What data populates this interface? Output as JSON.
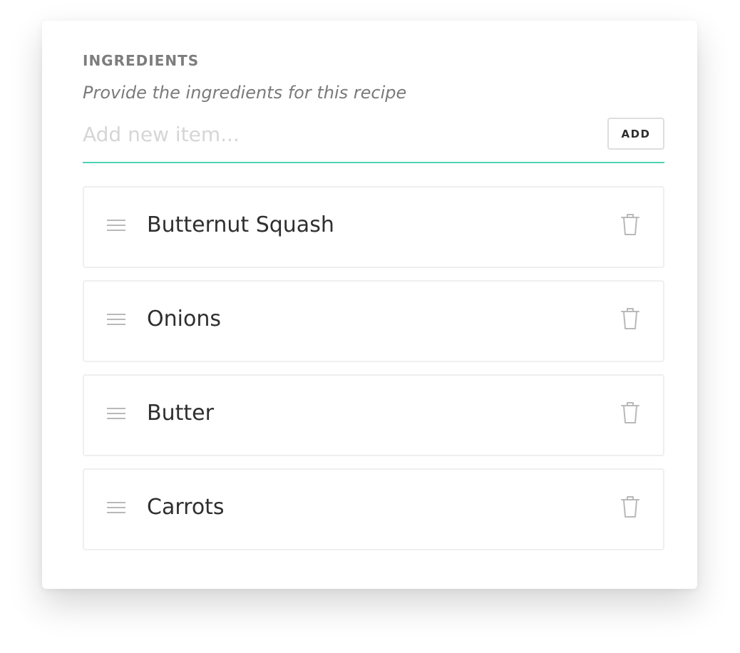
{
  "ingredients": {
    "title": "INGREDIENTS",
    "subtitle": "Provide the ingredients for this recipe",
    "input": {
      "placeholder": "Add new item...",
      "value": ""
    },
    "add_label": "ADD",
    "items": [
      {
        "label": "Butternut Squash"
      },
      {
        "label": "Onions"
      },
      {
        "label": "Butter"
      },
      {
        "label": "Carrots"
      }
    ]
  },
  "icons": {
    "drag": "drag-handle-icon",
    "delete": "trash-icon"
  },
  "colors": {
    "accent": "#4fd3b3",
    "title_text": "#7d7d7d",
    "item_text": "#2f2f2f",
    "placeholder_text": "#d6d6d6",
    "icon": "#b9b9b9",
    "border": "#efefef"
  }
}
